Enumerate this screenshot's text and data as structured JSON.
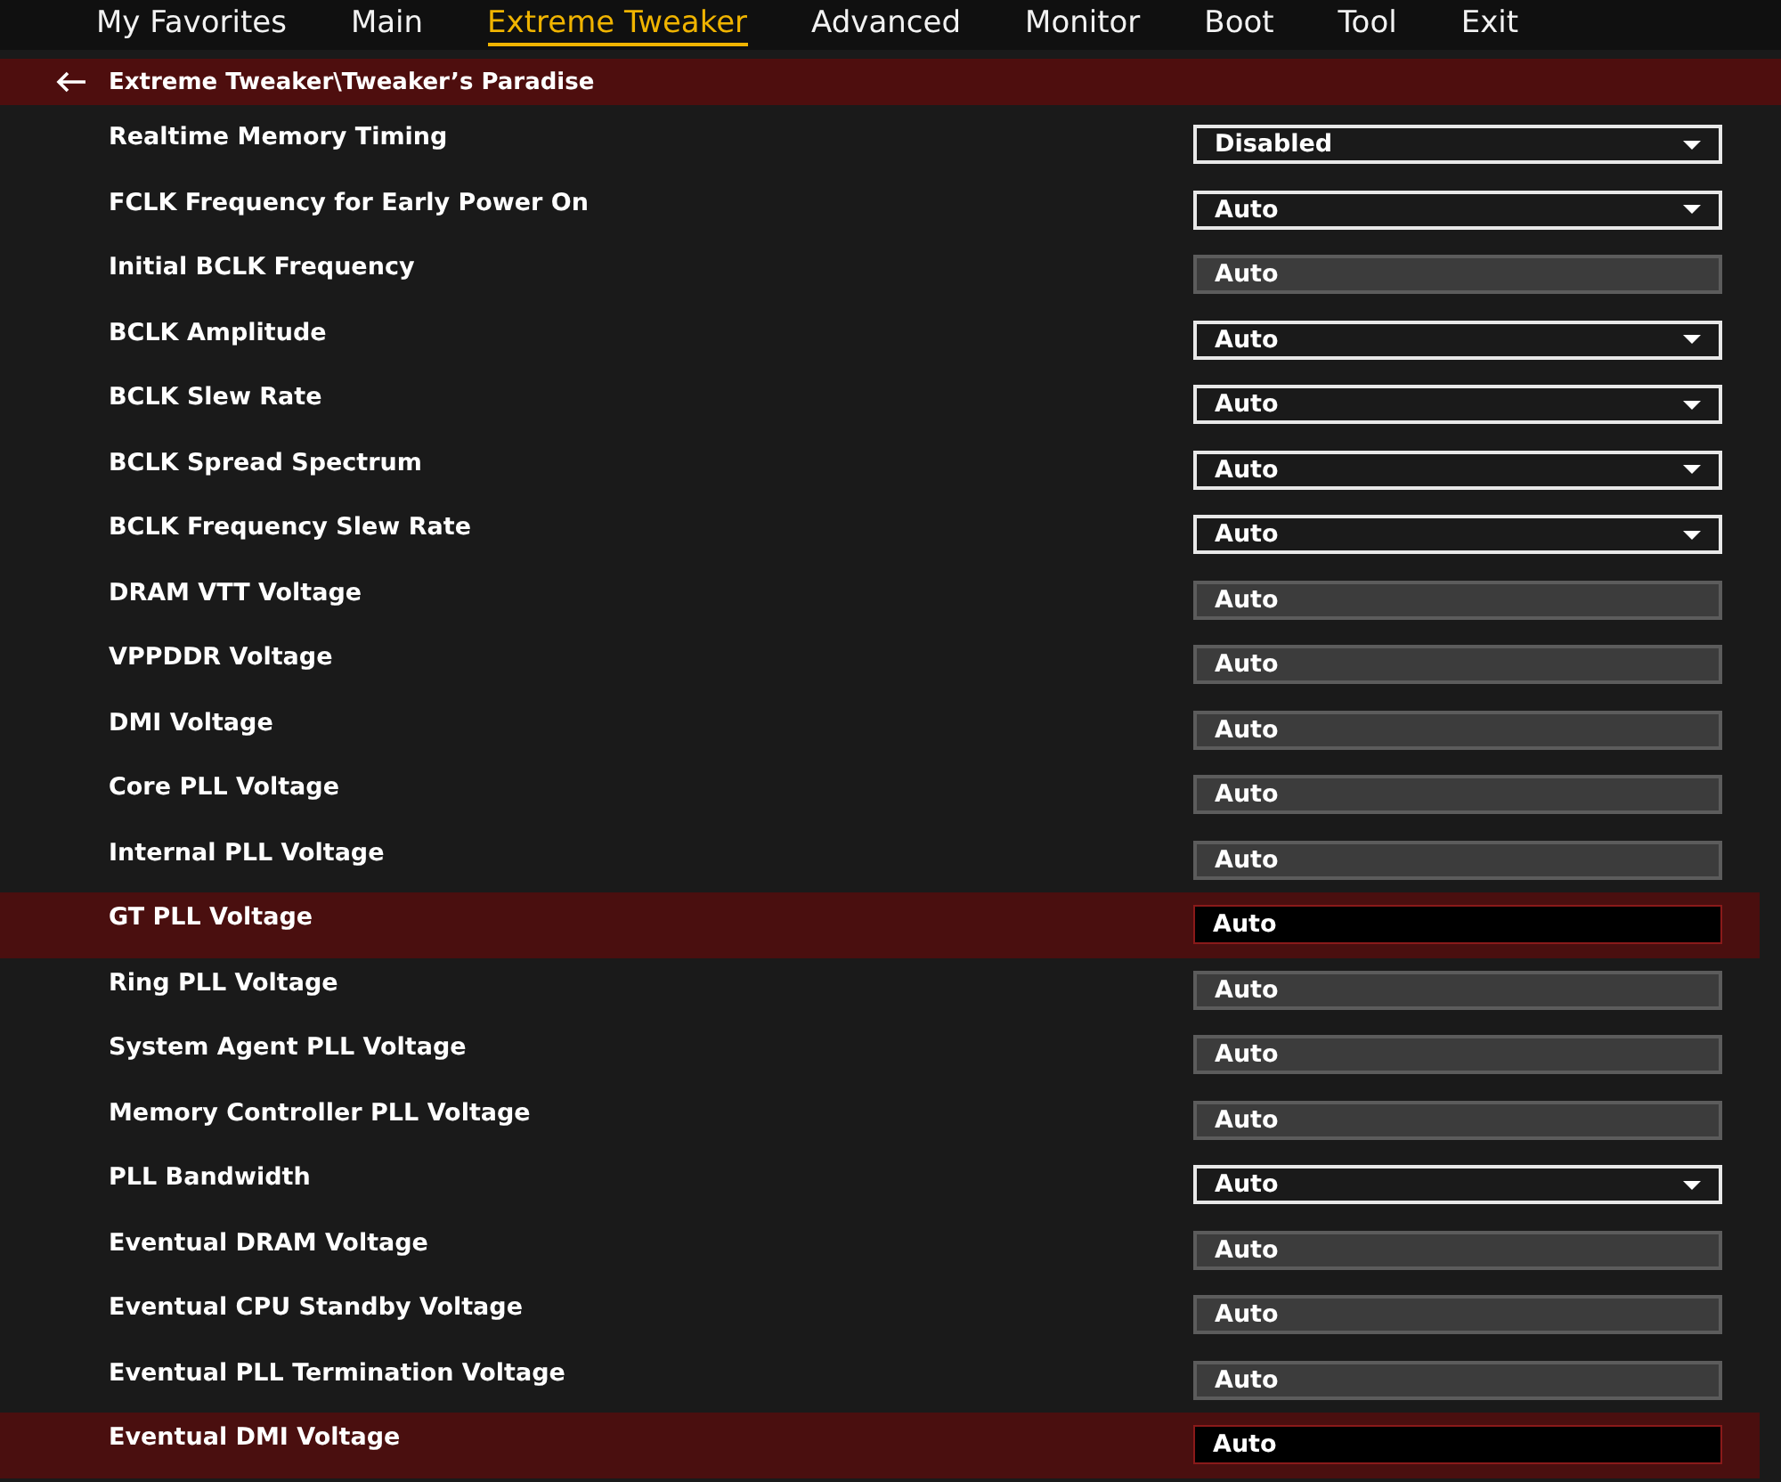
{
  "menu": [
    {
      "label": "My Favorites",
      "selected": false
    },
    {
      "label": "Main",
      "selected": false
    },
    {
      "label": "Extreme Tweaker",
      "selected": true
    },
    {
      "label": "Advanced",
      "selected": false
    },
    {
      "label": "Monitor",
      "selected": false
    },
    {
      "label": "Boot",
      "selected": false
    },
    {
      "label": "Tool",
      "selected": false
    },
    {
      "label": "Exit",
      "selected": false
    }
  ],
  "breadcrumb": "Extreme Tweaker\\Tweaker’s Paradise",
  "settings": [
    {
      "label": "Realtime Memory Timing",
      "kind": "dropdown",
      "value": "Disabled",
      "selected": false
    },
    {
      "label": "FCLK Frequency for Early Power On",
      "kind": "dropdown",
      "value": "Auto",
      "selected": false
    },
    {
      "label": "Initial BCLK Frequency",
      "kind": "field",
      "value": "Auto",
      "selected": false
    },
    {
      "label": "BCLK Amplitude",
      "kind": "dropdown",
      "value": "Auto",
      "selected": false
    },
    {
      "label": "BCLK Slew Rate",
      "kind": "dropdown",
      "value": "Auto",
      "selected": false
    },
    {
      "label": "BCLK Spread Spectrum",
      "kind": "dropdown",
      "value": "Auto",
      "selected": false
    },
    {
      "label": "BCLK Frequency Slew Rate",
      "kind": "dropdown",
      "value": "Auto",
      "selected": false
    },
    {
      "label": "DRAM VTT Voltage",
      "kind": "field",
      "value": "Auto",
      "selected": false
    },
    {
      "label": "VPPDDR Voltage",
      "kind": "field",
      "value": "Auto",
      "selected": false
    },
    {
      "label": "DMI Voltage",
      "kind": "field",
      "value": "Auto",
      "selected": false
    },
    {
      "label": "Core PLL Voltage",
      "kind": "field",
      "value": "Auto",
      "selected": false
    },
    {
      "label": "Internal PLL Voltage",
      "kind": "field",
      "value": "Auto",
      "selected": false
    },
    {
      "label": "GT PLL Voltage",
      "kind": "field",
      "value": "Auto",
      "selected": true
    },
    {
      "label": "Ring PLL Voltage",
      "kind": "field",
      "value": "Auto",
      "selected": false
    },
    {
      "label": "System Agent PLL Voltage",
      "kind": "field",
      "value": "Auto",
      "selected": false
    },
    {
      "label": "Memory Controller PLL Voltage",
      "kind": "field",
      "value": "Auto",
      "selected": false
    },
    {
      "label": "PLL Bandwidth",
      "kind": "dropdown",
      "value": "Auto",
      "selected": false
    },
    {
      "label": "Eventual DRAM Voltage",
      "kind": "field",
      "value": "Auto",
      "selected": false
    },
    {
      "label": "Eventual CPU Standby Voltage",
      "kind": "field",
      "value": "Auto",
      "selected": false
    },
    {
      "label": "Eventual PLL Termination Voltage",
      "kind": "field",
      "value": "Auto",
      "selected": false
    },
    {
      "label": "Eventual DMI Voltage",
      "kind": "field",
      "value": "Auto",
      "selected": true
    }
  ]
}
